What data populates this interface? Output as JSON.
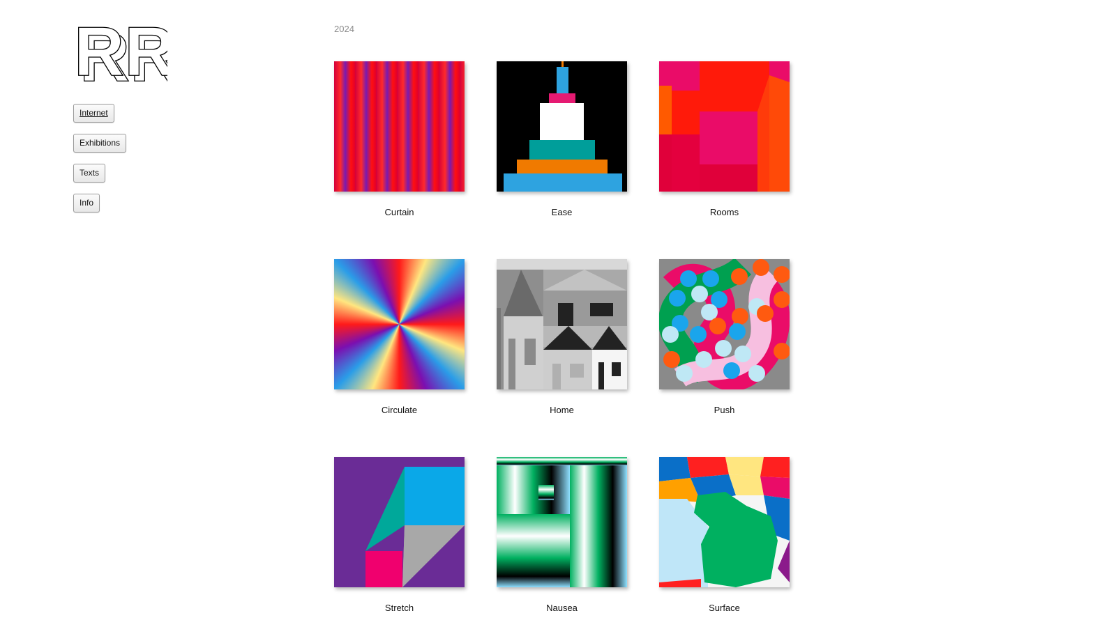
{
  "logo": {
    "text": "RR"
  },
  "nav": {
    "items": [
      {
        "label": "Internet",
        "active": true
      },
      {
        "label": "Exhibitions",
        "active": false
      },
      {
        "label": "Texts",
        "active": false
      },
      {
        "label": "Info",
        "active": false
      }
    ]
  },
  "gallery": {
    "year": "2024",
    "works": [
      {
        "title": "Curtain"
      },
      {
        "title": "Ease"
      },
      {
        "title": "Rooms"
      },
      {
        "title": "Circulate"
      },
      {
        "title": "Home"
      },
      {
        "title": "Push"
      },
      {
        "title": "Stretch"
      },
      {
        "title": "Nausea"
      },
      {
        "title": "Surface"
      }
    ]
  }
}
